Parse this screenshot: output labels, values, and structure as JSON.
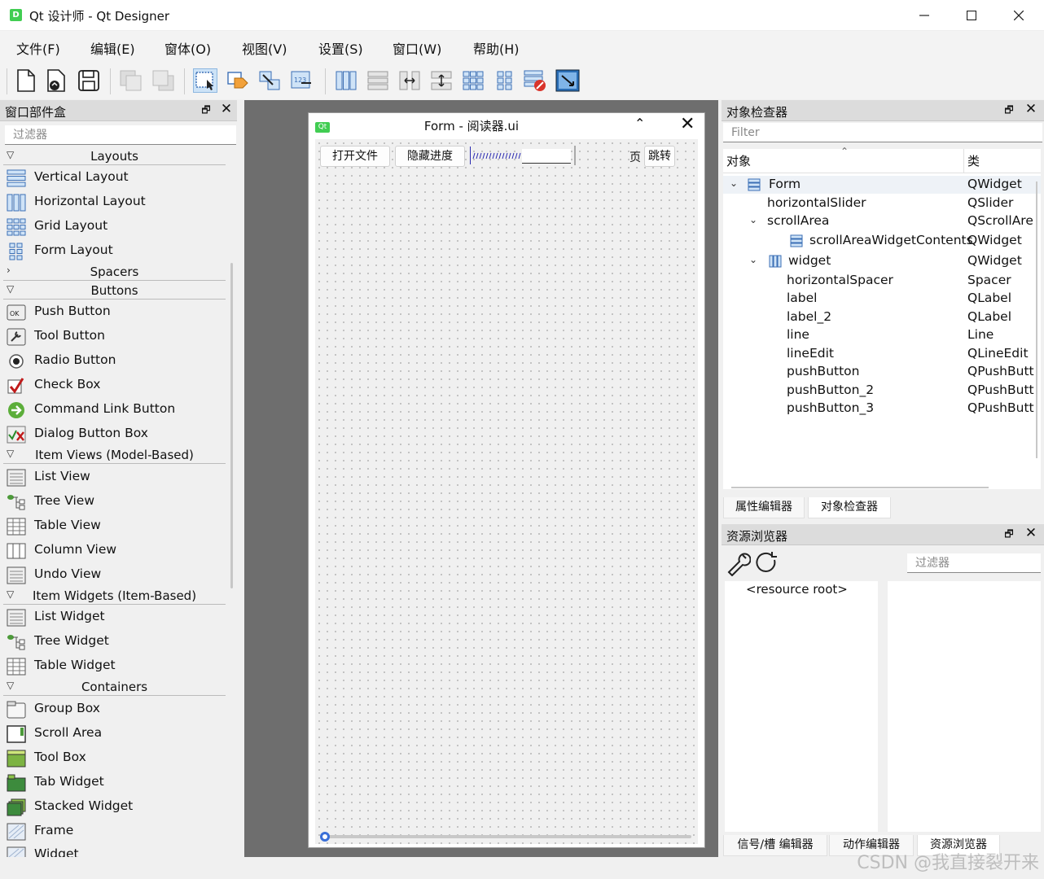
{
  "window": {
    "title": "Qt 设计师 - Qt Designer",
    "icon_letter": "D"
  },
  "menu": [
    "文件(F)",
    "编辑(E)",
    "窗体(O)",
    "视图(V)",
    "设置(S)",
    "窗口(W)",
    "帮助(H)"
  ],
  "widget_box": {
    "title": "窗口部件盒",
    "filter_placeholder": "过滤器",
    "categories": {
      "layouts": "Layouts",
      "spacers": "Spacers",
      "buttons": "Buttons",
      "item_views": "Item Views (Model-Based)",
      "item_widgets": "Item Widgets (Item-Based)",
      "containers": "Containers"
    },
    "layouts": [
      "Vertical Layout",
      "Horizontal Layout",
      "Grid Layout",
      "Form Layout"
    ],
    "buttons": [
      "Push Button",
      "Tool Button",
      "Radio Button",
      "Check Box",
      "Command Link Button",
      "Dialog Button Box"
    ],
    "item_views": [
      "List View",
      "Tree View",
      "Table View",
      "Column View",
      "Undo View"
    ],
    "item_widgets": [
      "List Widget",
      "Tree Widget",
      "Table Widget"
    ],
    "containers": [
      "Group Box",
      "Scroll Area",
      "Tool Box",
      "Tab Widget",
      "Stacked Widget",
      "Frame",
      "Widget"
    ]
  },
  "form": {
    "title": "Form - 阅读器.ui",
    "qt_badge": "Qt",
    "open_button": "打开文件",
    "hide_button": "隐藏进度",
    "page_label": "页",
    "jump_button": "跳转"
  },
  "object_inspector": {
    "title": "对象检查器",
    "filter_placeholder": "Filter",
    "col_object": "对象",
    "col_class": "类",
    "rows": [
      {
        "name": "Form",
        "cls": "QWidget"
      },
      {
        "name": "horizontalSlider",
        "cls": "QSlider"
      },
      {
        "name": "scrollArea",
        "cls": "QScrollAre"
      },
      {
        "name": "scrollAreaWidgetContents",
        "cls": "QWidget"
      },
      {
        "name": "widget",
        "cls": "QWidget"
      },
      {
        "name": "horizontalSpacer",
        "cls": "Spacer"
      },
      {
        "name": "label",
        "cls": "QLabel"
      },
      {
        "name": "label_2",
        "cls": "QLabel"
      },
      {
        "name": "line",
        "cls": "Line"
      },
      {
        "name": "lineEdit",
        "cls": "QLineEdit"
      },
      {
        "name": "pushButton",
        "cls": "QPushButt"
      },
      {
        "name": "pushButton_2",
        "cls": "QPushButt"
      },
      {
        "name": "pushButton_3",
        "cls": "QPushButt"
      }
    ],
    "tabs": [
      "属性编辑器",
      "对象检查器"
    ]
  },
  "resource_browser": {
    "title": "资源浏览器",
    "filter_placeholder": "过滤器",
    "root": "<resource root>",
    "tabs": [
      "信号/槽 编辑器",
      "动作编辑器",
      "资源浏览器"
    ]
  },
  "watermark": "CSDN @我直接裂开来"
}
